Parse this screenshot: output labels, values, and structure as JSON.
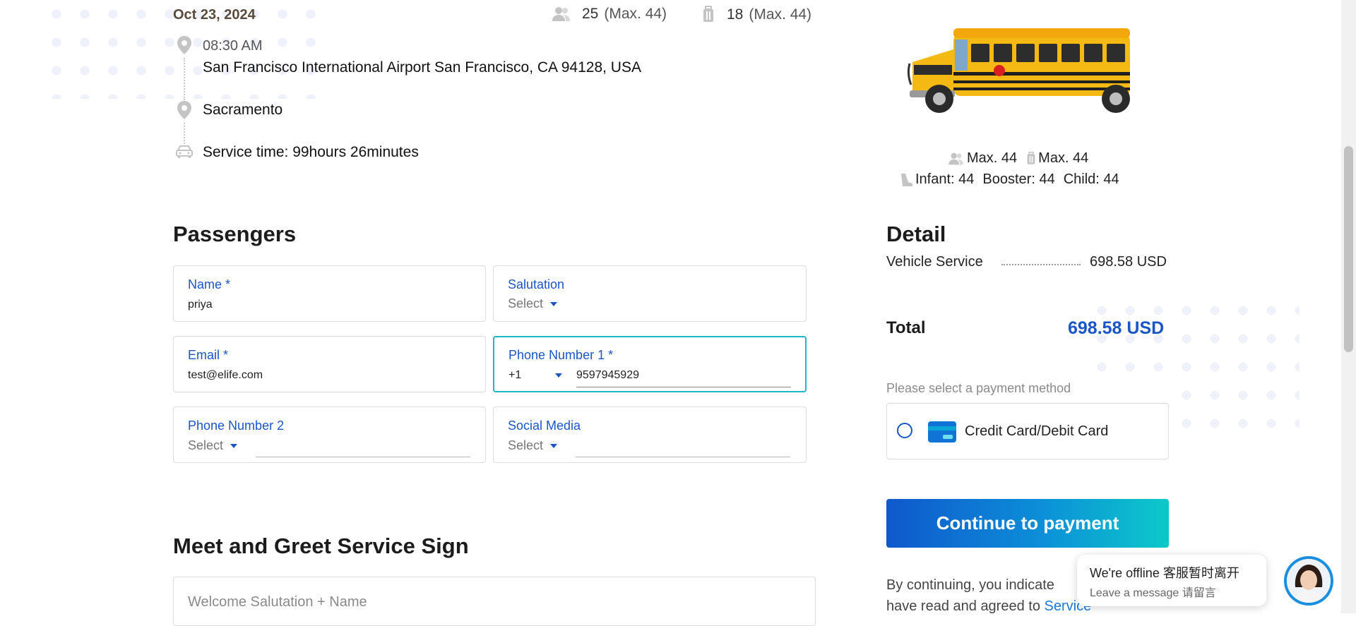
{
  "trip": {
    "date": "Oct 23, 2024",
    "passengers_count": "25",
    "passengers_max": "(Max. 44)",
    "luggage_count": "18",
    "luggage_max": "(Max. 44)",
    "pickup_time": "08:30 AM",
    "pickup_address": "San Francisco International Airport San Francisco, CA 94128, USA",
    "dropoff": "Sacramento",
    "service_time": "Service time: 99hours 26minutes"
  },
  "vehicle": {
    "max_passengers": "Max. 44",
    "max_luggage": "Max. 44",
    "infant": "Infant: 44",
    "booster": "Booster: 44",
    "child": "Child: 44"
  },
  "passengers": {
    "heading": "Passengers",
    "name_label": "Name *",
    "name_value": "priya",
    "salutation_label": "Salutation",
    "salutation_value": "Select",
    "email_label": "Email *",
    "email_value": "test@elife.com",
    "phone1_label": "Phone Number 1 *",
    "phone1_code": "+1",
    "phone1_value": "9597945929",
    "phone2_label": "Phone Number 2",
    "phone2_select": "Select",
    "social_label": "Social Media",
    "social_select": "Select"
  },
  "meet_greet": {
    "heading": "Meet and Greet Service Sign",
    "placeholder": "Welcome Salutation + Name"
  },
  "detail": {
    "heading": "Detail",
    "vehicle_service_label": "Vehicle Service",
    "vehicle_service_value": "698.58 USD",
    "total_label": "Total",
    "total_value": "698.58 USD",
    "payment_prompt": "Please select a payment method",
    "payment_option": "Credit Card/Debit Card",
    "continue_label": "Continue to payment",
    "terms_line1": "By continuing, you indicate",
    "terms_line2": "have read and agreed to",
    "terms_link": "Service"
  },
  "chat": {
    "status": "We're offline 客服暂时离开",
    "prompt": "Leave a message 请留言"
  },
  "colors": {
    "accent_blue": "#1a56c6",
    "teal": "#1bb8c9",
    "button_gradient_start": "#0f58cc",
    "button_gradient_end": "#0cc9c9"
  }
}
